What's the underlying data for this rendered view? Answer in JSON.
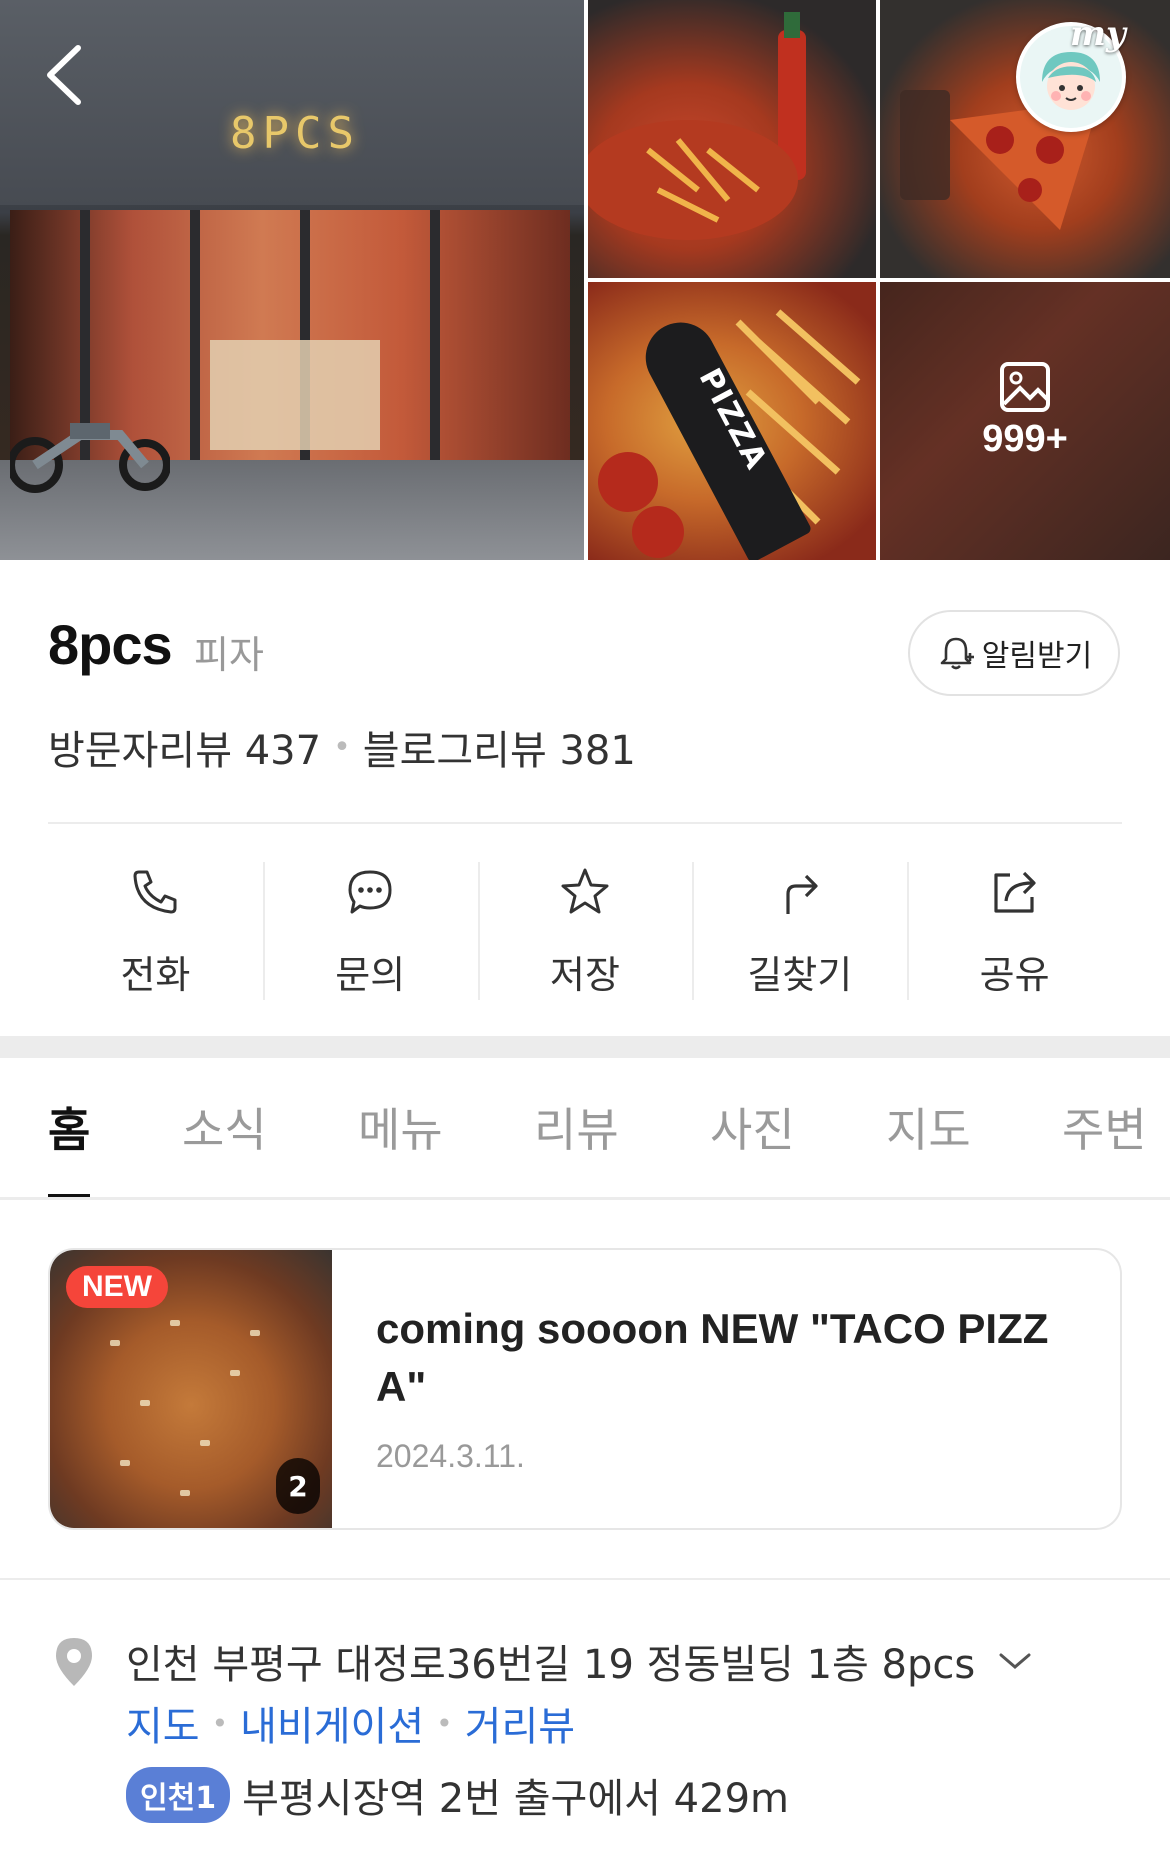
{
  "gallery": {
    "store_sign": "8PCS",
    "pizza_tool_text": "PIZZA",
    "photo_count": "999+",
    "my_text": "my"
  },
  "place": {
    "name": "8pcs",
    "category": "피자",
    "alarm_label": "알림받기",
    "visitor_review": "방문자리뷰 437",
    "blog_review": "블로그리뷰 381"
  },
  "actions": [
    {
      "label": "전화",
      "icon": "phone-icon"
    },
    {
      "label": "문의",
      "icon": "chat-icon"
    },
    {
      "label": "저장",
      "icon": "star-icon"
    },
    {
      "label": "길찾기",
      "icon": "directions-icon"
    },
    {
      "label": "공유",
      "icon": "share-icon"
    }
  ],
  "tabs": [
    "홈",
    "소식",
    "메뉴",
    "리뷰",
    "사진",
    "지도",
    "주변"
  ],
  "news": {
    "badge": "NEW",
    "count": "2",
    "title": "coming soooon NEW \"TACO PIZZA\"",
    "date": "2024.3.11."
  },
  "location": {
    "address": "인천 부평구 대정로36번길 19 정동빌딩 1층 8pcs",
    "links": [
      "지도",
      "내비게이션",
      "거리뷰"
    ],
    "subway_line": "인천1",
    "subway_text": "부평시장역 2번 출구에서 429m"
  },
  "colors": {
    "accent_blue": "#2a6cd6",
    "new_badge": "#f5453a",
    "subway_line": "#5a7fd6"
  }
}
